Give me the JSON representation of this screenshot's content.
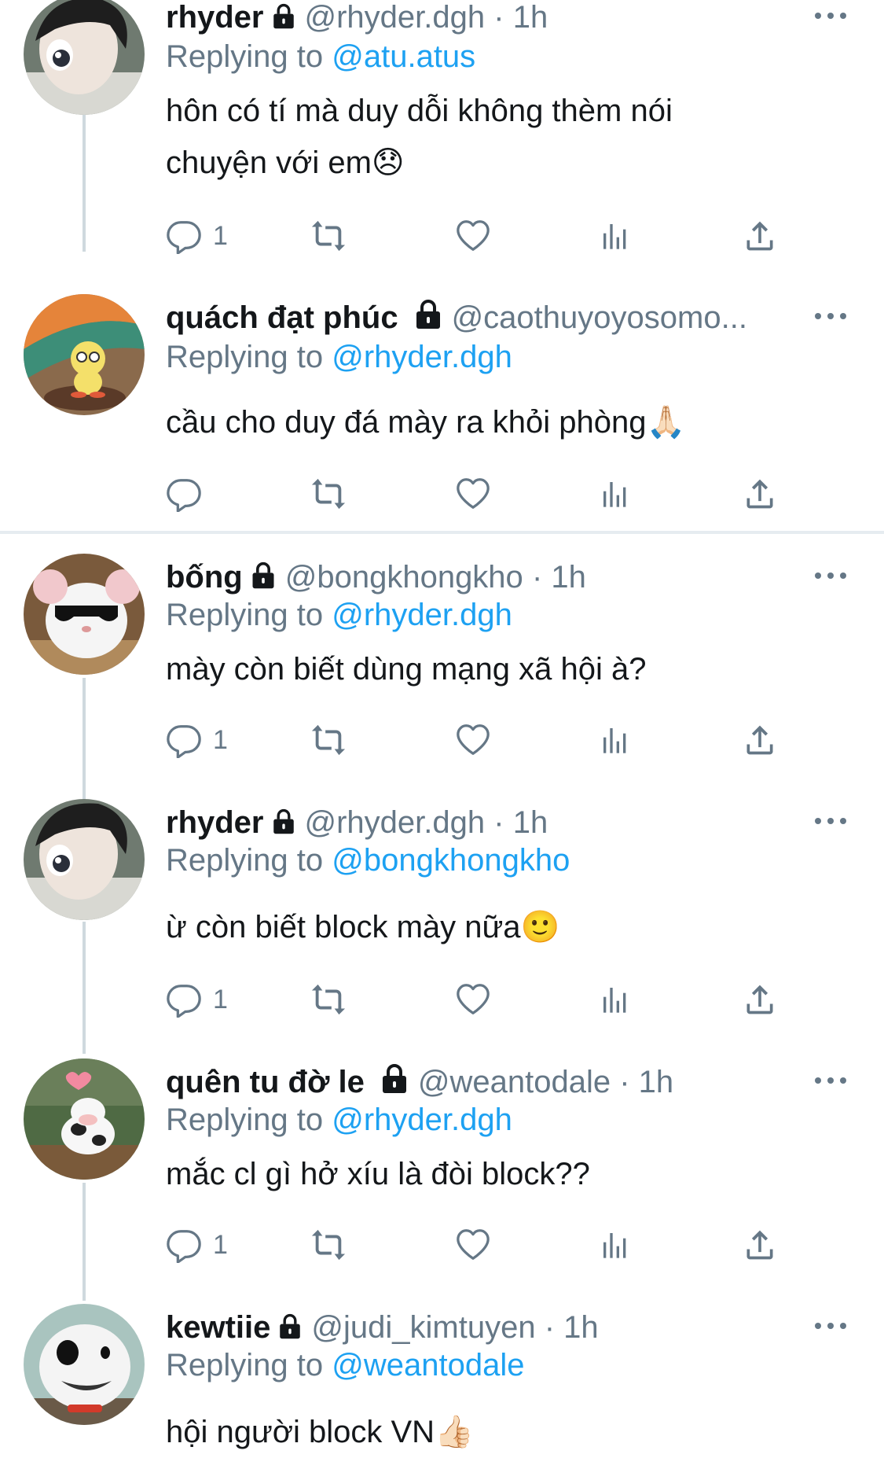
{
  "tweets": [
    {
      "name": "rhyder",
      "handle": "@rhyder.dgh",
      "separator": "·",
      "time": "1h",
      "replying_label": "Replying to",
      "replying_to": "@atu.atus",
      "text_line1": "hôn có tí mà duy dỗi không thèm nói",
      "text_line2": "chuyện với em😞",
      "reply_count": "1"
    },
    {
      "name": "quách đạt phúc",
      "handle": "@caothuyoyosomo...",
      "replying_label": "Replying to",
      "replying_to": "@rhyder.dgh",
      "text_line1": "cầu cho duy đá mày ra khỏi phòng🙏🏻",
      "reply_count": ""
    },
    {
      "name": "bống",
      "handle": "@bongkhongkho",
      "separator": "·",
      "time": "1h",
      "replying_label": "Replying to",
      "replying_to": "@rhyder.dgh",
      "text_line1": "mày còn biết dùng mạng xã hội à?",
      "reply_count": "1"
    },
    {
      "name": "rhyder",
      "handle": "@rhyder.dgh",
      "separator": "·",
      "time": "1h",
      "replying_label": "Replying to",
      "replying_to": "@bongkhongkho",
      "text_line1": "ừ còn biết block mày nữa🙂",
      "reply_count": "1"
    },
    {
      "name": "quên tu đờ le",
      "handle": "@weantodale",
      "separator": "·",
      "time": "1h",
      "replying_label": "Replying to",
      "replying_to": "@rhyder.dgh",
      "text_line1": "mắc cl gì hở xíu là đòi block??",
      "reply_count": "1"
    },
    {
      "name": "kewtiie",
      "handle": "@judi_kimtuyen",
      "separator": "·",
      "time": "1h",
      "replying_label": "Replying to",
      "replying_to": "@weantodale",
      "text_line1": "hội người block VN👍🏻"
    }
  ],
  "colors": {
    "text": "#14171a",
    "secondary": "#657786",
    "link": "#1da1f2",
    "thread_line": "#cfd9de",
    "divider": "#e6ecf0"
  },
  "icons": {
    "reply": "speech-bubble-icon",
    "retweet": "retweet-arrows-icon",
    "like": "heart-outline-icon",
    "analytics": "bar-chart-icon",
    "share": "upload-arrow-icon",
    "more": "more-dots-icon",
    "lock": "lock-icon"
  }
}
